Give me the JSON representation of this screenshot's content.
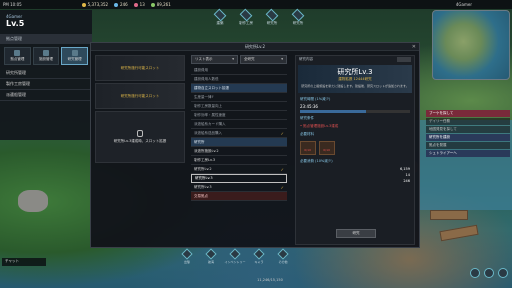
{
  "status": {
    "time": "PM 10:05",
    "signal": "||||",
    "currency": [
      {
        "value": "5,373,352",
        "color": "#e0b848"
      },
      {
        "value": "246",
        "color": "#6ab8e8"
      },
      {
        "value": "13",
        "color": "#e06a8a"
      },
      {
        "value": "89,261",
        "color": "#8ac868"
      }
    ],
    "player": "4Gamer"
  },
  "topnav": [
    "建築",
    "制作工房",
    "研究所",
    "研究所"
  ],
  "left": {
    "name": "4Gamer",
    "level": "Lv.5",
    "section": "拠点管理",
    "tabs": [
      "拠点管理",
      "施設管理",
      "研究管理"
    ],
    "list": [
      "研究所管理",
      "製作工房管理",
      "派遣船管理"
    ]
  },
  "window": {
    "title": "研究所Lv.2",
    "slots": [
      "研究所施行可能スロット",
      "研究所施行可能スロット",
      "研究所Lv.3達成時、スロット拡張"
    ],
    "filter": "リスト表示",
    "filter2": "全研究",
    "items": [
      {
        "label": "建設費用",
        "kind": "dim"
      },
      {
        "label": "建設費用人数低",
        "kind": "dim"
      },
      {
        "label": "建物自立スロット拡張",
        "kind": "cat"
      },
      {
        "label": "生産量一律↑",
        "kind": "dim"
      },
      {
        "label": "制作工房数量向上",
        "kind": "dim"
      },
      {
        "label": "制作効率・属性速度",
        "kind": "dim"
      },
      {
        "label": "派遣船系カード購入",
        "kind": "dim"
      },
      {
        "label": "派遣船系送品購入",
        "kind": "dim",
        "check": true
      },
      {
        "label": "研究所",
        "kind": "cat"
      },
      {
        "label": "派遣所施設Lv.2",
        "kind": "bright"
      },
      {
        "label": "制作工房Lv.3",
        "kind": "bright"
      },
      {
        "label": "研究所Lv.2",
        "kind": "bright",
        "check": true
      },
      {
        "label": "研究所Lv.3",
        "kind": "sel"
      },
      {
        "label": "研究所Lv.3",
        "kind": "bright",
        "check": true
      },
      {
        "label": "交易拠点",
        "kind": "red"
      }
    ],
    "detail": {
      "header": "研究内容",
      "name": "研究所Lv.3",
      "sub": "建物拡張 12444研究",
      "desc": "研究所の上級施設を新たに建設します。建設後、研究スロットが追加されます。",
      "time_label": "研究時間 (1%減少)",
      "time": "23:45:36",
      "cond_label": "研究条件",
      "cond": "• 拠点管理施設Lv.3達成",
      "mat_label": "必要材料",
      "mats": [
        "0/10",
        "0/10"
      ],
      "cost_label": "必要消費 (10%減少)",
      "cost1": "6,159",
      "cost2": "14",
      "cost3": "246",
      "button": "研究"
    }
  },
  "quests": [
    {
      "t": "ブーケを探して",
      "k": "h"
    },
    {
      "t": "デイリー任務",
      "k": "s"
    },
    {
      "t": "地図発見を探して",
      "k": "s"
    },
    {
      "t": "研究所を建設",
      "k": "h2"
    },
    {
      "t": "拠点を発展",
      "k": "s"
    },
    {
      "t": "シュトライアーへ",
      "k": "h2"
    }
  ],
  "chat": "チャット",
  "bottom": [
    "出撃",
    "航海",
    "インベントリー",
    "キャラ",
    "その他"
  ],
  "xp": "11,246/15,150"
}
